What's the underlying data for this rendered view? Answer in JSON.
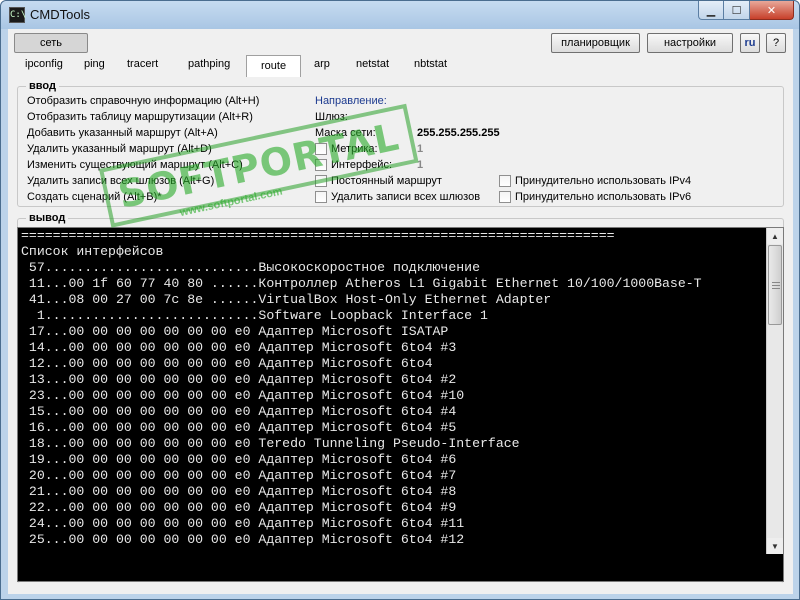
{
  "window": {
    "title": "CMDTools",
    "app_icon": "C:\\",
    "controls": {
      "minimize": "▁",
      "maximize": "☐",
      "close": "✕"
    }
  },
  "top_buttons": {
    "network": "сеть",
    "scheduler": "планировщик",
    "settings": "настройки",
    "language": "ru",
    "help": "?"
  },
  "tabs": [
    "ipconfig",
    "ping",
    "tracert",
    "pathping",
    "route",
    "arp",
    "netstat",
    "nbtstat"
  ],
  "active_tab": "route",
  "input_group": {
    "title": "ввод",
    "actions": [
      "Отобразить справочную информацию (Alt+H)",
      "Отобразить таблицу маршрутизации (Alt+R)",
      "Добавить указанный маршрут (Alt+A)",
      "Удалить указанный маршрут (Alt+D)",
      "Изменить существующий маршрут (Alt+C)",
      "Удалить записи всех шлюзов (Alt+G)",
      "Создать сценарий (Alt+B)*"
    ],
    "direction_label": "Направление:",
    "gateway_label": "Шлюз:",
    "mask_label": "Маска сети:",
    "mask_value": "255.255.255.255",
    "metric_label": "Метрика:",
    "metric_value": "1",
    "interface_label": "Интерфейс:",
    "interface_value": "1",
    "persistent_route": "Постоянный маршрут",
    "delete_all_gateways": "Удалить записи всех шлюзов",
    "force_ipv4": "Принудительно использовать IPv4",
    "force_ipv6": "Принудительно использовать IPv6"
  },
  "output_group": {
    "title": "вывод",
    "lines": [
      "===========================================================================",
      "Список интерфейсов",
      " 57...........................Высокоскоростное подключение",
      " 11...00 1f 60 77 40 80 ......Контроллер Atheros L1 Gigabit Ethernet 10/100/1000Base-T",
      " 41...08 00 27 00 7c 8e ......VirtualBox Host-Only Ethernet Adapter",
      "  1...........................Software Loopback Interface 1",
      " 17...00 00 00 00 00 00 00 e0 Адаптер Microsoft ISATAP",
      " 14...00 00 00 00 00 00 00 e0 Адаптер Microsoft 6to4 #3",
      " 12...00 00 00 00 00 00 00 e0 Адаптер Microsoft 6to4",
      " 13...00 00 00 00 00 00 00 e0 Адаптер Microsoft 6to4 #2",
      " 23...00 00 00 00 00 00 00 e0 Адаптер Microsoft 6to4 #10",
      " 15...00 00 00 00 00 00 00 e0 Адаптер Microsoft 6to4 #4",
      " 16...00 00 00 00 00 00 00 e0 Адаптер Microsoft 6to4 #5",
      " 18...00 00 00 00 00 00 00 e0 Teredo Tunneling Pseudo-Interface",
      " 19...00 00 00 00 00 00 00 e0 Адаптер Microsoft 6to4 #6",
      " 20...00 00 00 00 00 00 00 e0 Адаптер Microsoft 6to4 #7",
      " 21...00 00 00 00 00 00 00 e0 Адаптер Microsoft 6to4 #8",
      " 22...00 00 00 00 00 00 00 e0 Адаптер Microsoft 6to4 #9",
      " 24...00 00 00 00 00 00 00 e0 Адаптер Microsoft 6to4 #11",
      " 25...00 00 00 00 00 00 00 e0 Адаптер Microsoft 6to4 #12"
    ]
  },
  "watermark": {
    "text": "SOFTPORTAL",
    "url": "www.softportal.com"
  },
  "icons": {
    "app": "console-icon",
    "scroll_up": "▲",
    "scroll_down": "▼"
  }
}
